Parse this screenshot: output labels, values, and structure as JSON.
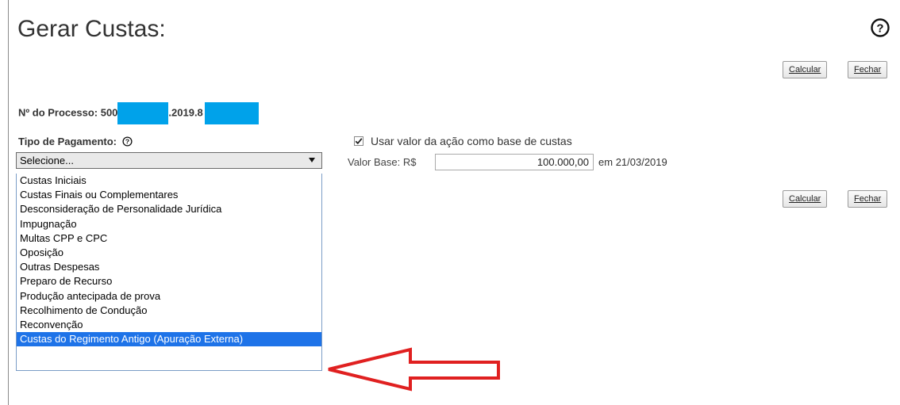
{
  "header": {
    "title": "Gerar Custas:",
    "help_icon": "help-circle-icon"
  },
  "toolbar": {
    "calcular_label": "Calcular",
    "fechar_label": "Fechar"
  },
  "processo": {
    "label": "Nº do Processo: 500",
    "mid": ".2019.8",
    "redaction_color": "#00a2ea"
  },
  "pagamento": {
    "label": "Tipo de Pagamento:",
    "selected": "Selecione...",
    "options": [
      "Custas Iniciais",
      "Custas Finais ou Complementares",
      "Desconsideração de Personalidade Jurídica",
      "Impugnação",
      "Multas CPP e CPC",
      "Oposição",
      "Outras Despesas",
      "Preparo de Recurso",
      "Produção antecipada de prova",
      "Recolhimento de Condução",
      "Reconvenção",
      "Custas do Regimento Antigo (Apuração Externa)"
    ],
    "highlighted_index": 11,
    "highlight_color": "#1e73e8"
  },
  "base": {
    "checkbox_label": "Usar valor da ação como base de custas",
    "checked": true,
    "valor_label": "Valor Base: R$",
    "valor": "100.000,00",
    "em_label": "em",
    "date": "21/03/2019"
  },
  "annotation": {
    "arrow_color": "#e02020",
    "arrow_icon": "left-arrow-icon"
  }
}
